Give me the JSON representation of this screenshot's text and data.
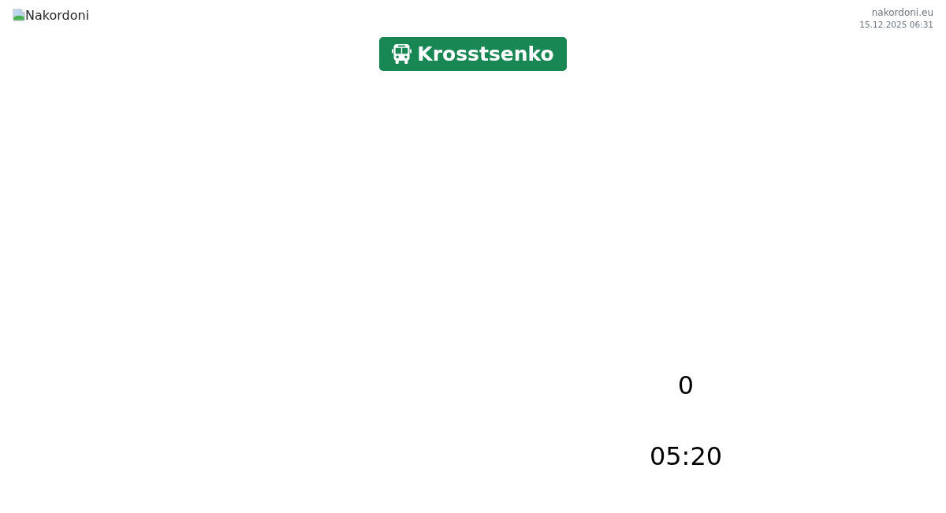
{
  "header": {
    "logo_alt": "Nakordoni",
    "site": "nakordoni.eu",
    "timestamp": "15.12.2025 06:31"
  },
  "route_badge": {
    "label": "Krosstsenko"
  },
  "stats": [
    {
      "value": "0"
    },
    {
      "value": "05:20"
    }
  ]
}
